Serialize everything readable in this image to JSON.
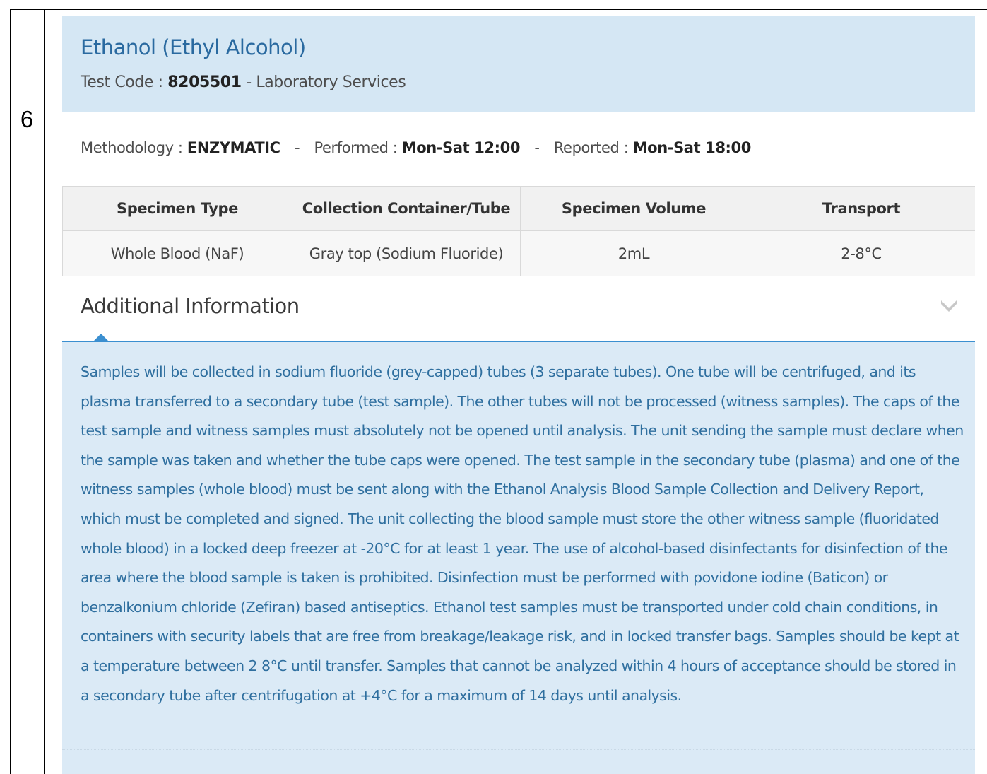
{
  "row_number": "6",
  "test": {
    "name": "Ethanol (Ethyl Alcohol)",
    "code_label": "Test Code : ",
    "code": "8205501",
    "provider": " - Laboratory Services"
  },
  "methodology": {
    "method_label": "Methodology : ",
    "method_value": "ENZYMATIC",
    "separator": "-",
    "performed_label": "Performed : ",
    "performed_value": "Mon-Sat 12:00",
    "reported_label": "Reported : ",
    "reported_value": "Mon-Sat 18:00"
  },
  "specimen_table": {
    "headers": [
      "Specimen Type",
      "Collection Container/Tube",
      "Specimen Volume",
      "Transport"
    ],
    "row": [
      "Whole Blood (NaF)",
      "Gray top (Sodium Fluoride)",
      "2mL",
      "2-8°C"
    ]
  },
  "additional_info": {
    "title": "Additional Information",
    "chevron_icon": "chevron-down-icon",
    "text": "Samples will be collected in sodium fluoride (grey-capped) tubes (3 separate tubes). One tube will be centrifuged, and its plasma transferred to a secondary tube (test sample). The other tubes will not be processed (witness samples). The caps of the test sample and witness samples must absolutely not be opened until analysis. The unit sending the sample must declare when the sample was taken and whether the tube caps were opened. The test sample in the secondary tube (plasma) and one of the witness samples (whole blood) must be sent along with the Ethanol Analysis Blood Sample Collection and Delivery Report, which must be completed and signed. The unit collecting the blood sample must store the other witness sample (fluoridated whole blood) in a locked deep freezer at -20°C for at least 1 year. The use of alcohol-based disinfectants for disinfection of the area where the blood sample is taken is prohibited. Disinfection must be performed with povidone iodine (Baticon) or benzalkonium chloride (Zefiran) based antiseptics. Ethanol test samples must be transported under cold chain conditions, in containers with security labels that are free from breakage/leakage risk, and in locked transfer bags. Samples should be kept at a temperature between 2  8°C until transfer. Samples that cannot be analyzed within 4 hours of acceptance should be stored in a secondary tube after centrifugation at +4°C for a maximum of 14 days until analysis."
  },
  "colors": {
    "header_bg": "#d5e7f4",
    "title_blue": "#2a6aa0",
    "body_text_blue": "#2f6f9f",
    "accent_blue": "#3b8fd0"
  }
}
